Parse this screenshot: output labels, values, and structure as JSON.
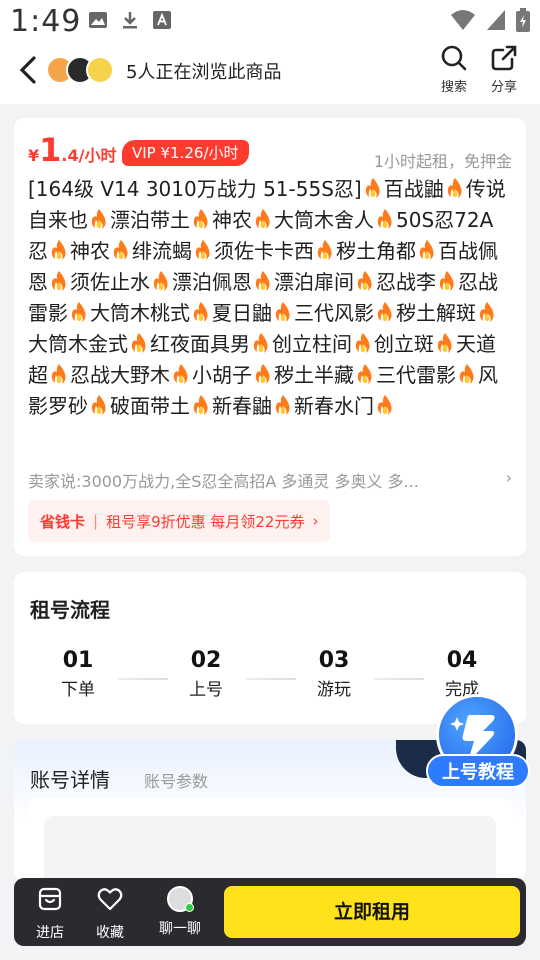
{
  "status_bar": {
    "time": "1:49"
  },
  "nav": {
    "title": "5人正在浏览此商品",
    "search_label": "搜索",
    "share_label": "分享"
  },
  "product": {
    "price_currency": "¥",
    "price_value": "1",
    "price_unit": ".4/小时",
    "vip_price": "VIP ¥1.26/小时",
    "min_rent": "1小时起租，免押金",
    "description_segments": [
      "[164级 V14 3010万战力 51-55S忍]",
      "百战鼬",
      "传说自来也",
      "漂泊带土",
      "神农",
      "大筒木舍人",
      "50S忍72A忍",
      "神农",
      "绯流蝎",
      "须佐卡卡西",
      "秽土角都",
      "百战佩恩",
      "须佐止水",
      "漂泊佩恩",
      "漂泊扉间",
      "忍战李",
      "忍战雷影",
      "大筒木桃式",
      "夏日鼬",
      "三代风影",
      "秽土解斑",
      "大筒木金式",
      "红夜面具男",
      "创立柱间",
      "创立斑",
      "天道超",
      "忍战大野木",
      "小胡子",
      "秽土半藏",
      "三代雷影",
      "风影罗砂",
      "破面带土",
      "新春鼬",
      "新春水门",
      ""
    ],
    "seller_note": "卖家说:3000万战力,全S忍全高招A 多通灵 多奥义 多...",
    "saver_tag": "省钱卡",
    "saver_text": "租号享9折优惠 每月领22元券"
  },
  "process": {
    "title": "租号流程",
    "steps": [
      {
        "num": "01",
        "label": "下单"
      },
      {
        "num": "02",
        "label": "上号"
      },
      {
        "num": "03",
        "label": "游玩"
      },
      {
        "num": "04",
        "label": "完成"
      }
    ]
  },
  "account": {
    "title": "账号详情",
    "subtitle": "账号参数"
  },
  "tutorial_label": "上号教程",
  "bottom": {
    "store_label": "进店",
    "favorite_label": "收藏",
    "chat_label": "聊一聊",
    "rent_label": "立即租用"
  },
  "colors": {
    "accent_red": "#ff3b2f",
    "accent_yellow": "#ffe21a",
    "tutorial_blue": "#2d7bff"
  }
}
